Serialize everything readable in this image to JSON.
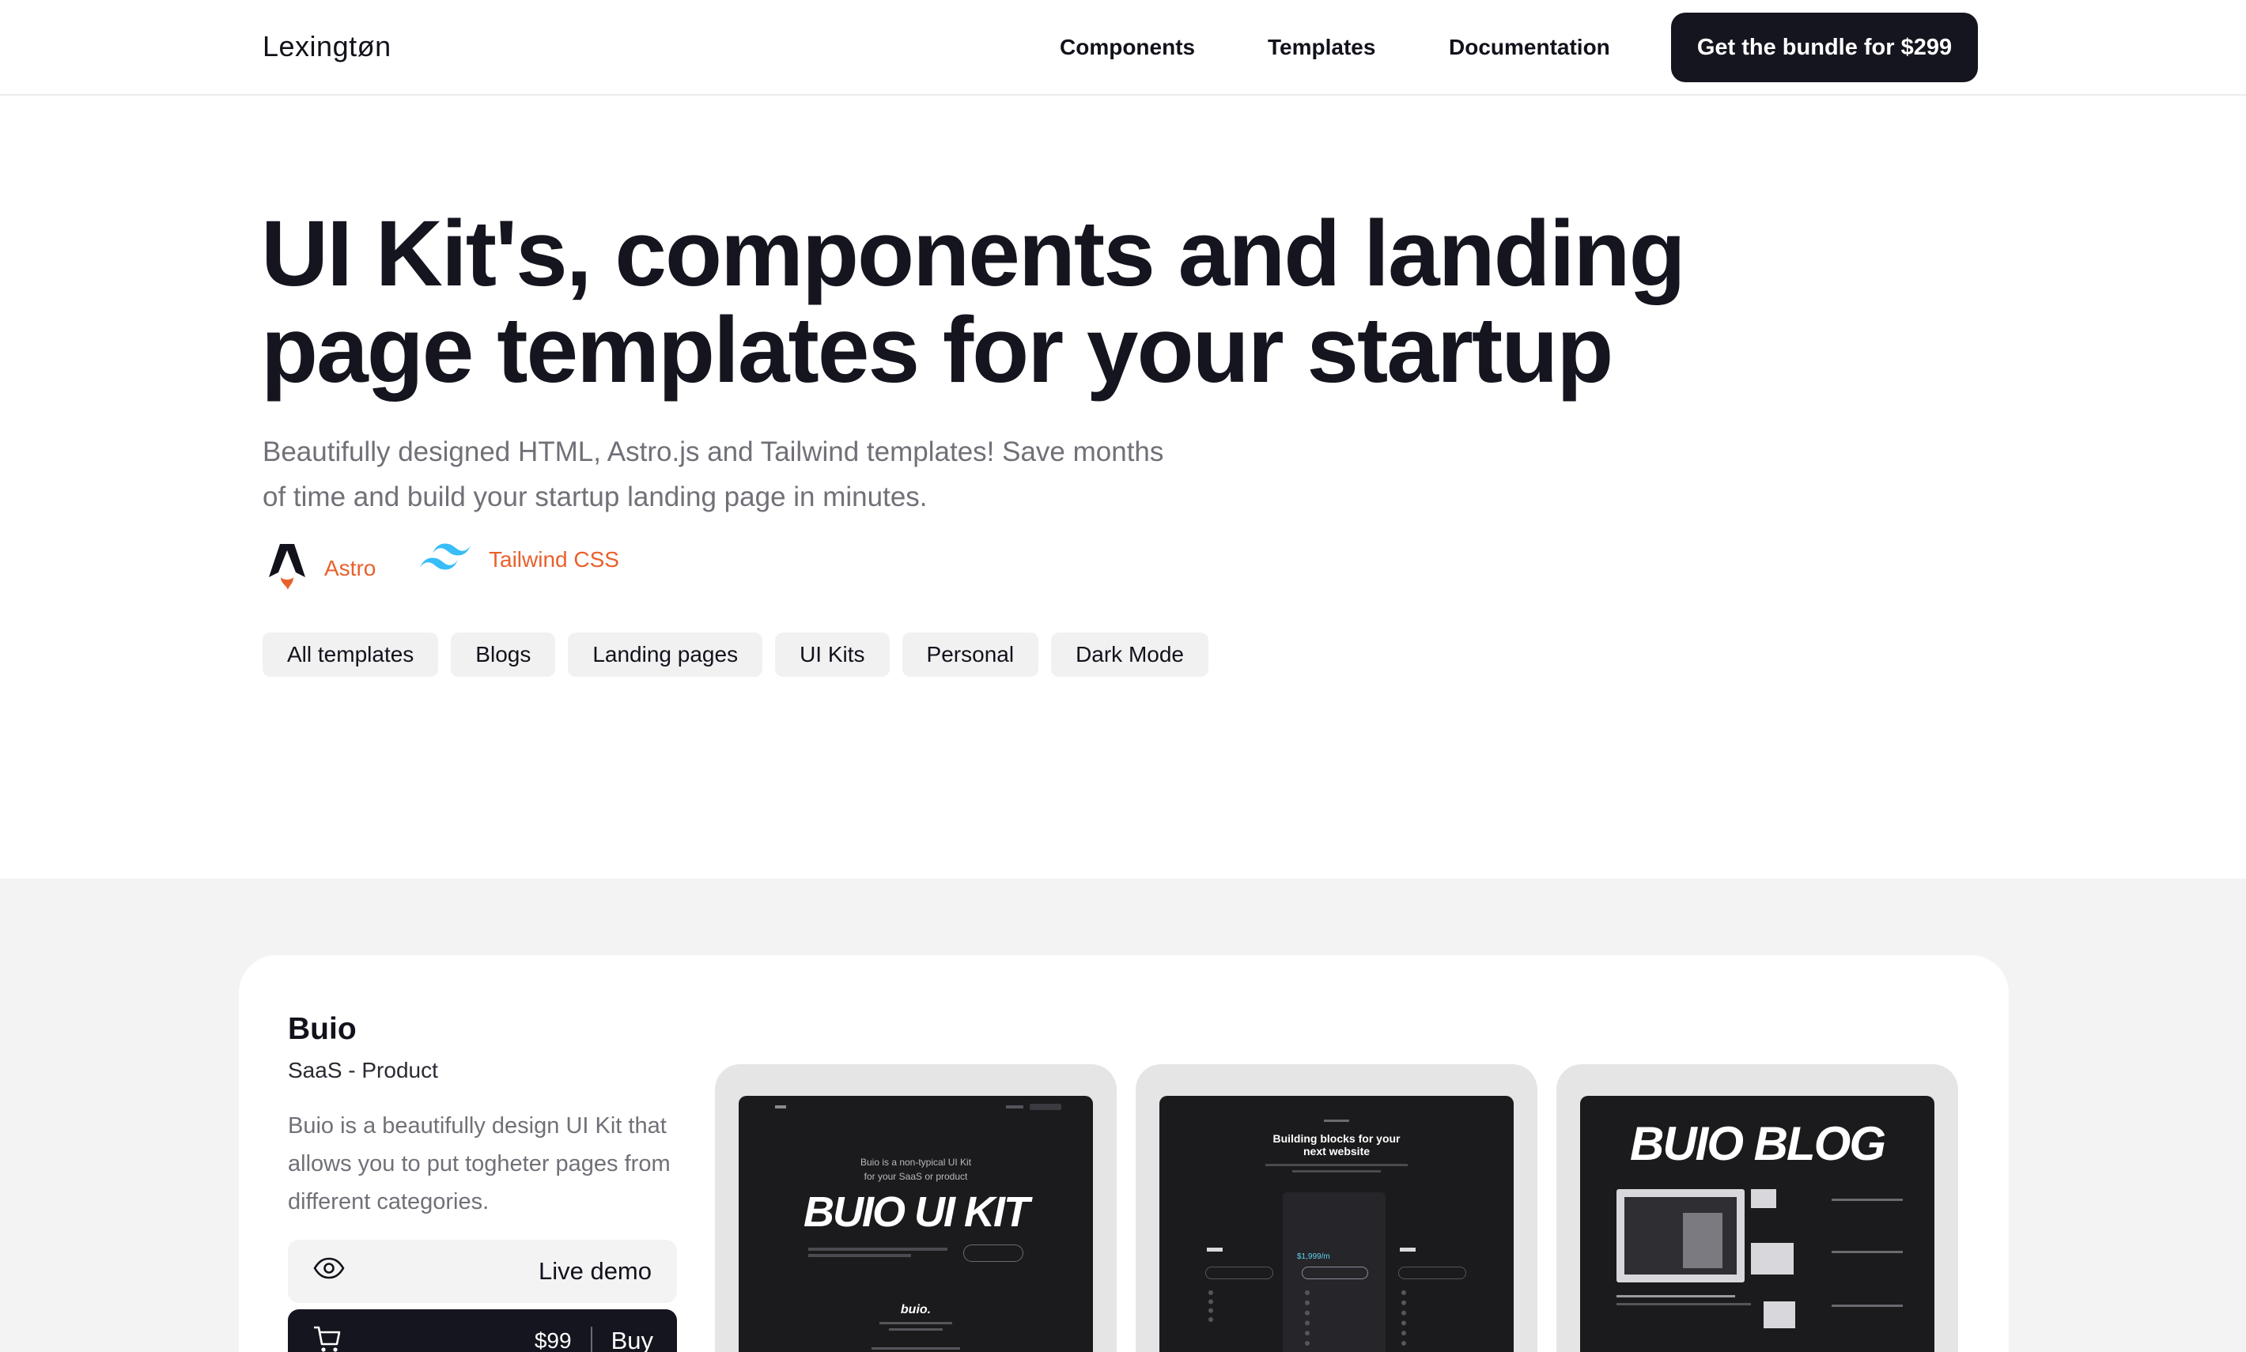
{
  "nav": {
    "logo": "Lexingtøn",
    "links": [
      "Components",
      "Templates",
      "Documentation"
    ],
    "cta": "Get the bundle for $299"
  },
  "hero": {
    "title": "UI Kit's, components and landing page templates for your startup",
    "subtitle": "Beautifully designed HTML, Astro.js and Tailwind templates! Save months of time and build your startup landing page in minutes.",
    "tech": [
      {
        "name": "Astro",
        "icon": "astro-icon"
      },
      {
        "name": "Tailwind CSS",
        "icon": "tailwind-icon"
      }
    ]
  },
  "filters": [
    "All templates",
    "Blogs",
    "Landing pages",
    "UI Kits",
    "Personal",
    "Dark Mode"
  ],
  "product": {
    "title": "Buio",
    "category": "SaaS - Product",
    "description": "Buio is a beautifully design UI Kit that allows you to put togheter pages from different categories.",
    "demo_label": "Live demo",
    "price": "$99",
    "buy_label": "Buy",
    "previews": {
      "p1": {
        "tagline_1": "Buio is a non-typical UI Kit",
        "tagline_2": "for your SaaS or product",
        "headline": "BUIO UI KIT",
        "logo": "buio."
      },
      "p2": {
        "heading_1": "Building blocks for your",
        "heading_2": "next website",
        "price": "$1,999/m"
      },
      "p3": {
        "headline": "BUIO BLOG"
      }
    }
  },
  "colors": {
    "accent": "#e8612c",
    "dark": "#15151f",
    "gray_bg": "#f3f3f3",
    "tailwind": "#38bdf8"
  }
}
